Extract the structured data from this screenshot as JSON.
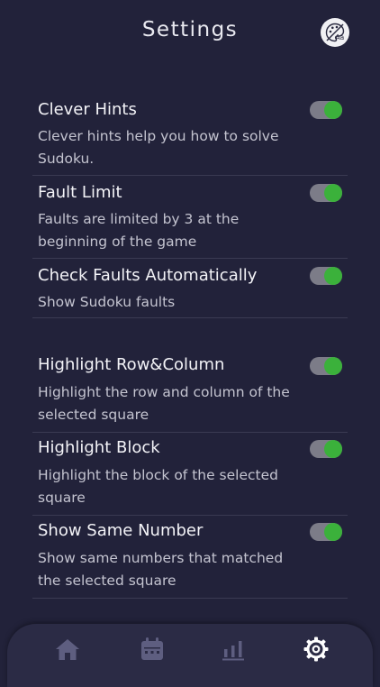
{
  "header": {
    "title": "Settings",
    "theme_button_icon": "theme-text-size-icon"
  },
  "sections": [
    {
      "items": [
        {
          "title": "Clever Hints",
          "description": "Clever hints help you how to solve Sudoku.",
          "enabled": true
        },
        {
          "title": "Fault Limit",
          "description": "Faults are limited by 3 at the beginning of the game",
          "enabled": true
        },
        {
          "title": "Check Faults Automatically",
          "description": "Show Sudoku faults",
          "enabled": true
        }
      ]
    },
    {
      "items": [
        {
          "title": "Highlight Row&Column",
          "description": "Highlight the row and column of the selected square",
          "enabled": true
        },
        {
          "title": "Highlight Block",
          "description": "Highlight the block of the selected square",
          "enabled": true
        },
        {
          "title": "Show Same Number",
          "description": "Show same numbers that matched the selected square",
          "enabled": true
        }
      ]
    }
  ],
  "tabbar": {
    "tabs": [
      {
        "icon": "home-icon",
        "active": false
      },
      {
        "icon": "calendar-icon",
        "active": false
      },
      {
        "icon": "stats-icon",
        "active": false
      },
      {
        "icon": "gear-icon",
        "active": true
      }
    ]
  },
  "colors": {
    "background": "#22223a",
    "toggle_on": "#3bb13b",
    "toggle_track": "#7c7c88",
    "tab_active": "#ffffff",
    "tab_inactive": "#5e5e80"
  }
}
